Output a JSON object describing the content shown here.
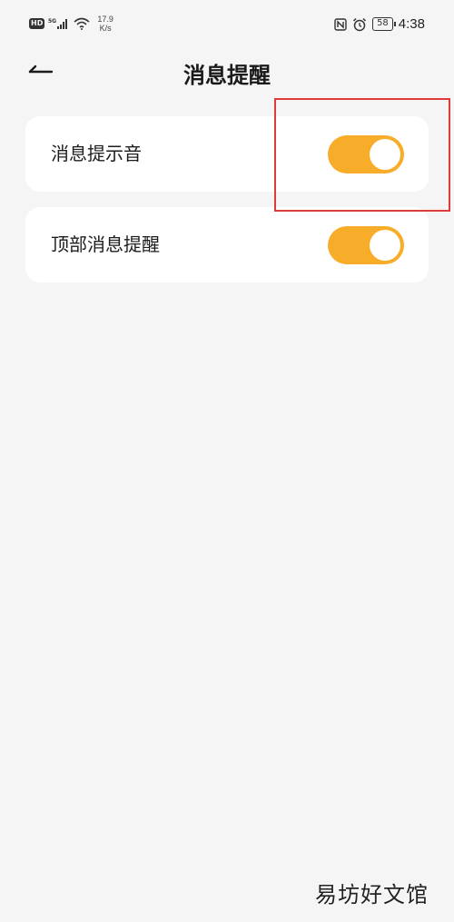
{
  "status_bar": {
    "hd": "HD",
    "network": "5G",
    "speed_value": "17.9",
    "speed_unit": "K/s",
    "battery": "58",
    "time": "4:38"
  },
  "header": {
    "title": "消息提醒"
  },
  "settings": [
    {
      "label": "消息提示音",
      "enabled": true
    },
    {
      "label": "顶部消息提醒",
      "enabled": true
    }
  ],
  "colors": {
    "toggle_on": "#f7ad2a",
    "highlight": "#e03a3a",
    "background": "#f5f5f5"
  },
  "watermark": "易坊好文馆"
}
